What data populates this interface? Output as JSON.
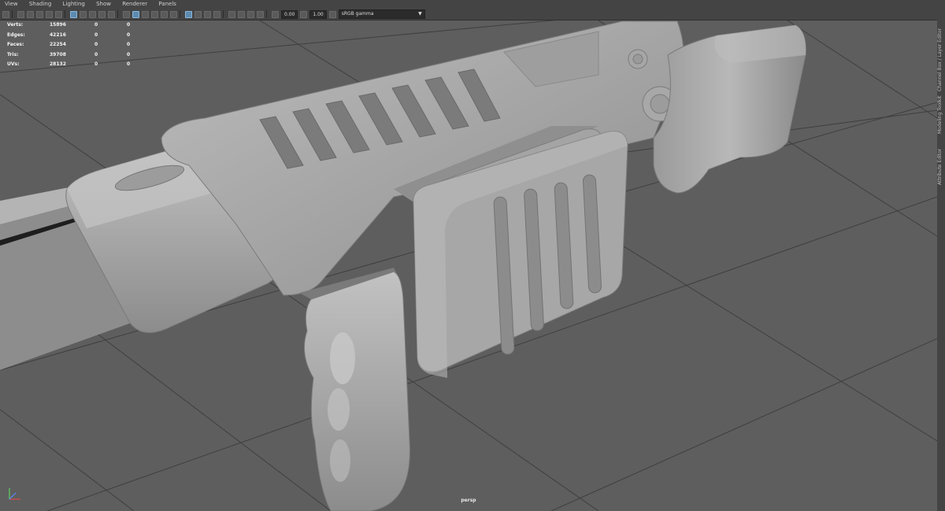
{
  "menu": [
    "View",
    "Shading",
    "Lighting",
    "Show",
    "Renderer",
    "Panels"
  ],
  "toolbar": {
    "exposure": "0.00",
    "gamma": "1.00",
    "color_space": "sRGB gamma"
  },
  "hud": {
    "rows": [
      {
        "label": "Verts:",
        "values": [
          "15896",
          "0",
          "0"
        ]
      },
      {
        "label": "Edges:",
        "values": [
          "42216",
          "0",
          "0"
        ]
      },
      {
        "label": "Faces:",
        "values": [
          "22254",
          "0",
          "0"
        ]
      },
      {
        "label": "Tris:",
        "values": [
          "39708",
          "0",
          "0"
        ]
      },
      {
        "label": "UVs:",
        "values": [
          "28132",
          "0",
          "0"
        ]
      }
    ]
  },
  "sidebar_tabs": [
    "Channel Box / Layer Editor",
    "Modeling Toolkit",
    "Attribute Editor"
  ],
  "camera": "persp",
  "colors": {
    "viewport_bg": "#5e5e5e",
    "ui_bg": "#444444",
    "grid_line": "#3c3c3c",
    "model": "#a4a4a4"
  }
}
